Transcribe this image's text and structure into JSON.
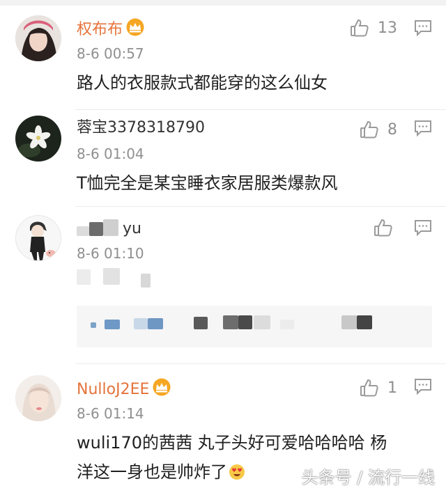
{
  "comments": [
    {
      "username": "权布布",
      "vip": true,
      "time": "8-6 00:57",
      "likes": "13",
      "text": "路人的衣服款式都能穿的这么仙女"
    },
    {
      "username": "蓉宝3378318790",
      "vip": false,
      "time": "8-6 01:04",
      "likes": "8",
      "text": "T恤完全是某宝睡衣家居服类爆款风"
    },
    {
      "username": "yu",
      "vip": false,
      "time": "8-6 01:10",
      "likes": "",
      "text": ""
    },
    {
      "username": "NulloJ2EE",
      "vip": true,
      "time": "8-6 01:14",
      "likes": "1",
      "text_line1": "wuli170的茜茜 丸子头好可爱哈哈哈哈  杨",
      "text_line2": "洋这一身也是帅炸了"
    }
  ],
  "watermark": "头条号 / 流行一线",
  "colors": {
    "vip_name": "#e5733b",
    "timestamp": "#8f8f8f",
    "icon": "#9a9a9a"
  },
  "icons": [
    "thumbs-up-icon",
    "reply-icon",
    "vip-crown-icon",
    "heart-eyes-emoji"
  ]
}
